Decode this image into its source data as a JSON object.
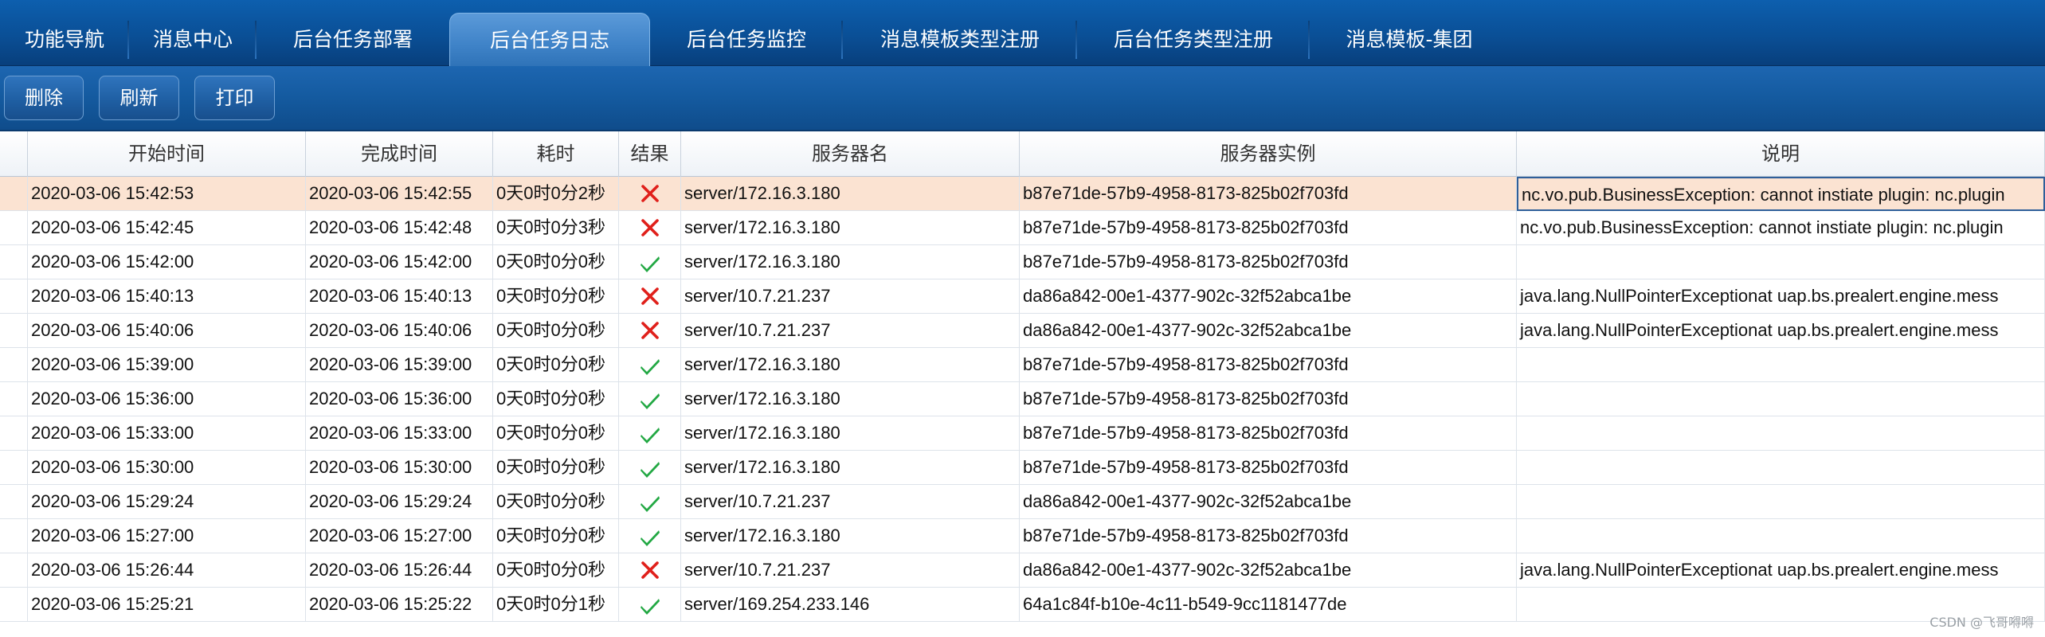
{
  "tabs": [
    {
      "label": "功能导航",
      "active": false
    },
    {
      "label": "消息中心",
      "active": false
    },
    {
      "label": "后台任务部署",
      "active": false
    },
    {
      "label": "后台任务日志",
      "active": true
    },
    {
      "label": "后台任务监控",
      "active": false
    },
    {
      "label": "消息模板类型注册",
      "active": false
    },
    {
      "label": "后台任务类型注册",
      "active": false
    },
    {
      "label": "消息模板-集团",
      "active": false
    }
  ],
  "toolbar": {
    "delete_label": "删除",
    "refresh_label": "刷新",
    "print_label": "打印"
  },
  "table": {
    "columns": [
      "开始时间",
      "完成时间",
      "耗时",
      "结果",
      "服务器名",
      "服务器实例",
      "说明"
    ],
    "rows": [
      {
        "start": "2020-03-06 15:42:53",
        "end": "2020-03-06 15:42:55",
        "duration": "0天0时0分2秒",
        "result": "fail",
        "server": "server/172.16.3.180",
        "instance": "b87e71de-57b9-4958-8173-825b02f703fd",
        "desc": "nc.vo.pub.BusinessException: cannot instiate plugin: nc.plugin",
        "selected": true
      },
      {
        "start": "2020-03-06 15:42:45",
        "end": "2020-03-06 15:42:48",
        "duration": "0天0时0分3秒",
        "result": "fail",
        "server": "server/172.16.3.180",
        "instance": "b87e71de-57b9-4958-8173-825b02f703fd",
        "desc": "nc.vo.pub.BusinessException: cannot instiate plugin: nc.plugin"
      },
      {
        "start": "2020-03-06 15:42:00",
        "end": "2020-03-06 15:42:00",
        "duration": "0天0时0分0秒",
        "result": "success",
        "server": "server/172.16.3.180",
        "instance": "b87e71de-57b9-4958-8173-825b02f703fd",
        "desc": ""
      },
      {
        "start": "2020-03-06 15:40:13",
        "end": "2020-03-06 15:40:13",
        "duration": "0天0时0分0秒",
        "result": "fail",
        "server": "server/10.7.21.237",
        "instance": "da86a842-00e1-4377-902c-32f52abca1be",
        "desc": "java.lang.NullPointerExceptionat uap.bs.prealert.engine.mess"
      },
      {
        "start": "2020-03-06 15:40:06",
        "end": "2020-03-06 15:40:06",
        "duration": "0天0时0分0秒",
        "result": "fail",
        "server": "server/10.7.21.237",
        "instance": "da86a842-00e1-4377-902c-32f52abca1be",
        "desc": "java.lang.NullPointerExceptionat uap.bs.prealert.engine.mess"
      },
      {
        "start": "2020-03-06 15:39:00",
        "end": "2020-03-06 15:39:00",
        "duration": "0天0时0分0秒",
        "result": "success",
        "server": "server/172.16.3.180",
        "instance": "b87e71de-57b9-4958-8173-825b02f703fd",
        "desc": ""
      },
      {
        "start": "2020-03-06 15:36:00",
        "end": "2020-03-06 15:36:00",
        "duration": "0天0时0分0秒",
        "result": "success",
        "server": "server/172.16.3.180",
        "instance": "b87e71de-57b9-4958-8173-825b02f703fd",
        "desc": ""
      },
      {
        "start": "2020-03-06 15:33:00",
        "end": "2020-03-06 15:33:00",
        "duration": "0天0时0分0秒",
        "result": "success",
        "server": "server/172.16.3.180",
        "instance": "b87e71de-57b9-4958-8173-825b02f703fd",
        "desc": ""
      },
      {
        "start": "2020-03-06 15:30:00",
        "end": "2020-03-06 15:30:00",
        "duration": "0天0时0分0秒",
        "result": "success",
        "server": "server/172.16.3.180",
        "instance": "b87e71de-57b9-4958-8173-825b02f703fd",
        "desc": ""
      },
      {
        "start": "2020-03-06 15:29:24",
        "end": "2020-03-06 15:29:24",
        "duration": "0天0时0分0秒",
        "result": "success",
        "server": "server/10.7.21.237",
        "instance": "da86a842-00e1-4377-902c-32f52abca1be",
        "desc": ""
      },
      {
        "start": "2020-03-06 15:27:00",
        "end": "2020-03-06 15:27:00",
        "duration": "0天0时0分0秒",
        "result": "success",
        "server": "server/172.16.3.180",
        "instance": "b87e71de-57b9-4958-8173-825b02f703fd",
        "desc": ""
      },
      {
        "start": "2020-03-06 15:26:44",
        "end": "2020-03-06 15:26:44",
        "duration": "0天0时0分0秒",
        "result": "fail",
        "server": "server/10.7.21.237",
        "instance": "da86a842-00e1-4377-902c-32f52abca1be",
        "desc": "java.lang.NullPointerExceptionat uap.bs.prealert.engine.mess"
      },
      {
        "start": "2020-03-06 15:25:21",
        "end": "2020-03-06 15:25:22",
        "duration": "0天0时0分1秒",
        "result": "success",
        "server": "server/169.254.233.146",
        "instance": "64a1c84f-b10e-4c11-b549-9cc1181477de",
        "desc": ""
      }
    ]
  },
  "result_icons": {
    "success": "check-icon",
    "fail": "cross-icon"
  },
  "colors": {
    "success": "#22a843",
    "fail": "#e0201b",
    "selected_row": "#fbe3d2",
    "tabbar": "#0a4f96"
  },
  "watermark": "CSDN @飞哥嘚嘚"
}
